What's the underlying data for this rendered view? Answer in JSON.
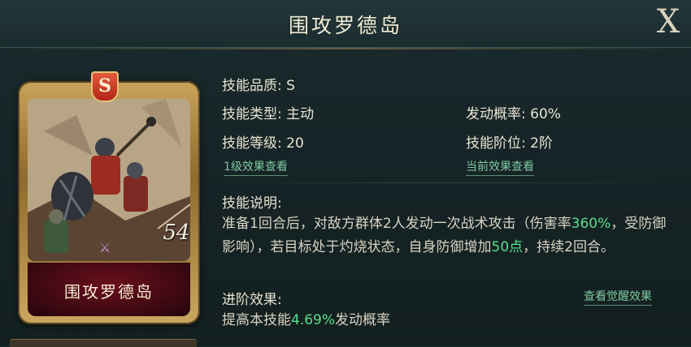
{
  "header": {
    "title": "围攻罗德岛",
    "close_label": "X"
  },
  "card": {
    "name": "围攻罗德岛",
    "grade_badge": "S",
    "art_number": "54",
    "crest_icon": "faction-crest-icon"
  },
  "skill": {
    "quality_label": "技能品质: S",
    "type_label": "技能类型: 主动",
    "trigger_rate_label": "发动概率: 60%",
    "level_label": "技能等级: 20",
    "tier_label": "技能阶位: 2阶",
    "link_level1": "1级效果查看",
    "link_current": "当前效果查看"
  },
  "description": {
    "title": "技能说明:",
    "part1": "准备1回合后，对敌方群体2人发动一次战术攻击（伤害率",
    "damage_rate": "360%",
    "part2": "，受防御影响），若目标处于灼烧状态，自身防御增加",
    "defense_bonus": "50点",
    "part3": "，持续2回合。"
  },
  "advancement": {
    "title": "进阶效果:",
    "link_awaken": "查看觉醒效果",
    "text_prefix": "提高本技能",
    "value": "4.69%",
    "text_suffix": "发动概率"
  },
  "colors": {
    "highlight": "#55e08b",
    "link": "#7fc9a0",
    "text": "#e8e3d2",
    "card_frame": "#c9a35a",
    "name_plate": "#6a0f1c"
  }
}
